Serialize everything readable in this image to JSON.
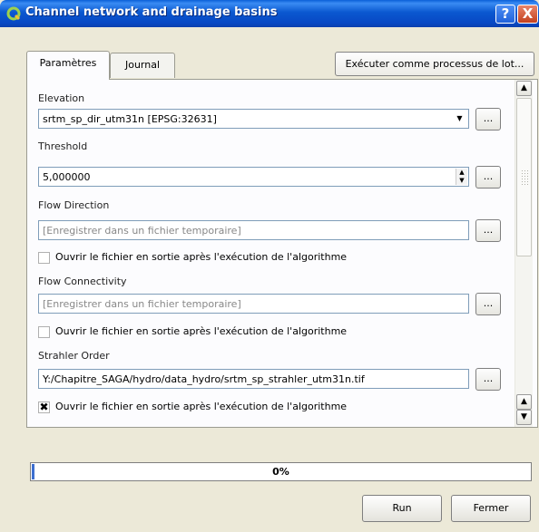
{
  "window": {
    "title": "Channel network and drainage basins",
    "help": "?",
    "close": "X"
  },
  "tabs": [
    "Paramètres",
    "Journal"
  ],
  "batch_button": "Exécuter comme processus de lot...",
  "fields": {
    "elevation": {
      "label": "Elevation",
      "value": "srtm_sp_dir_utm31n [EPSG:32631]"
    },
    "threshold": {
      "label": "Threshold",
      "value": "5,000000"
    },
    "flow_direction": {
      "label": "Flow Direction",
      "placeholder": "[Enregistrer dans un fichier temporaire]",
      "checkbox_label": "Ouvrir le fichier en sortie après l'exécution de l'algorithme",
      "checked": false
    },
    "flow_connectivity": {
      "label": "Flow Connectivity",
      "placeholder": "[Enregistrer dans un fichier temporaire]",
      "checkbox_label": "Ouvrir le fichier en sortie après l'exécution de l'algorithme",
      "checked": false
    },
    "strahler_order": {
      "label": "Strahler Order",
      "value": "Y:/Chapitre_SAGA/hydro/data_hydro/srtm_sp_strahler_utm31n.tif",
      "checkbox_label": "Ouvrir le fichier en sortie après l'exécution de l'algorithme",
      "checked": true
    }
  },
  "browse_label": "...",
  "progress": {
    "text": "0%",
    "value": 0
  },
  "buttons": {
    "run": "Run",
    "close": "Fermer"
  },
  "colors": {
    "titlebar": "#0a58d0",
    "progress_fill": "#3d6fd0"
  }
}
